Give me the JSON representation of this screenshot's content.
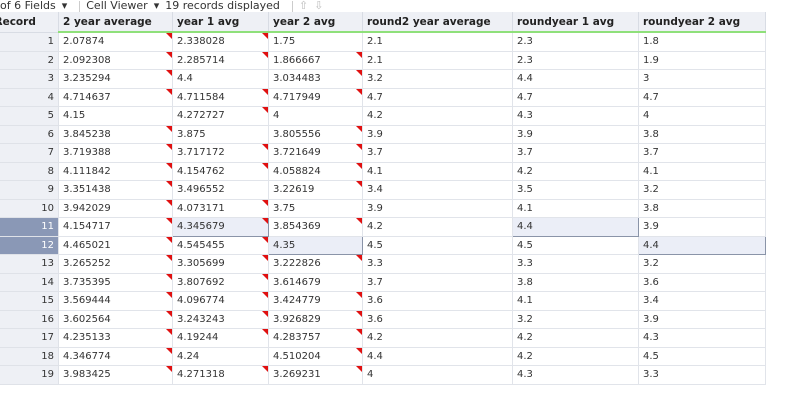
{
  "toolbar": {
    "fields": "of 6 Fields",
    "cell_viewer": "Cell Viewer",
    "records": "19 records displayed"
  },
  "columns": [
    "Record",
    "2 year average",
    "year 1 avg",
    "year 2 avg",
    "round2 year average",
    "roundyear 1 avg",
    "roundyear 2 avg"
  ],
  "rows": [
    [
      "1",
      "2.07874",
      "2.338028",
      "1.75",
      "2.1",
      "2.3",
      "1.8"
    ],
    [
      "2",
      "2.092308",
      "2.285714",
      "1.866667",
      "2.1",
      "2.3",
      "1.9"
    ],
    [
      "3",
      "3.235294",
      "4.4",
      "3.034483",
      "3.2",
      "4.4",
      "3"
    ],
    [
      "4",
      "4.714637",
      "4.711584",
      "4.717949",
      "4.7",
      "4.7",
      "4.7"
    ],
    [
      "5",
      "4.15",
      "4.272727",
      "4",
      "4.2",
      "4.3",
      "4"
    ],
    [
      "6",
      "3.845238",
      "3.875",
      "3.805556",
      "3.9",
      "3.9",
      "3.8"
    ],
    [
      "7",
      "3.719388",
      "3.717172",
      "3.721649",
      "3.7",
      "3.7",
      "3.7"
    ],
    [
      "8",
      "4.111842",
      "4.154762",
      "4.058824",
      "4.1",
      "4.2",
      "4.1"
    ],
    [
      "9",
      "3.351438",
      "3.496552",
      "3.22619",
      "3.4",
      "3.5",
      "3.2"
    ],
    [
      "10",
      "3.942029",
      "4.073171",
      "3.75",
      "3.9",
      "4.1",
      "3.8"
    ],
    [
      "11",
      "4.154717",
      "4.345679",
      "3.854369",
      "4.2",
      "4.4",
      "3.9"
    ],
    [
      "12",
      "4.465021",
      "4.545455",
      "4.35",
      "4.5",
      "4.5",
      "4.4"
    ],
    [
      "13",
      "3.265252",
      "3.305699",
      "3.222826",
      "3.3",
      "3.3",
      "3.2"
    ],
    [
      "14",
      "3.735395",
      "3.807692",
      "3.614679",
      "3.7",
      "3.8",
      "3.6"
    ],
    [
      "15",
      "3.569444",
      "4.096774",
      "3.424779",
      "3.6",
      "4.1",
      "3.4"
    ],
    [
      "16",
      "3.602564",
      "3.243243",
      "3.926829",
      "3.6",
      "3.2",
      "3.9"
    ],
    [
      "17",
      "4.235133",
      "4.19244",
      "4.283757",
      "4.2",
      "4.2",
      "4.3"
    ],
    [
      "18",
      "4.346774",
      "4.24",
      "4.510204",
      "4.4",
      "4.2",
      "4.5"
    ],
    [
      "19",
      "3.983425",
      "4.271318",
      "3.269231",
      "4",
      "4.3",
      "3.3"
    ]
  ],
  "flags": [
    [
      1,
      1,
      0
    ],
    [
      1,
      1,
      1
    ],
    [
      1,
      0,
      1
    ],
    [
      1,
      1,
      1
    ],
    [
      0,
      1,
      0
    ],
    [
      1,
      0,
      1
    ],
    [
      1,
      1,
      1
    ],
    [
      1,
      1,
      1
    ],
    [
      1,
      0,
      1
    ],
    [
      1,
      1,
      0
    ],
    [
      1,
      1,
      1
    ],
    [
      1,
      1,
      0
    ],
    [
      1,
      1,
      1
    ],
    [
      1,
      1,
      0
    ],
    [
      1,
      1,
      1
    ],
    [
      1,
      1,
      1
    ],
    [
      1,
      1,
      1
    ],
    [
      1,
      0,
      1
    ],
    [
      1,
      1,
      1
    ]
  ],
  "selected_rows": [
    "11",
    "12"
  ],
  "colors": {
    "header_underline": "#8fe07a",
    "flag": "#e01010",
    "selected_row_header": "#8a98b6"
  }
}
